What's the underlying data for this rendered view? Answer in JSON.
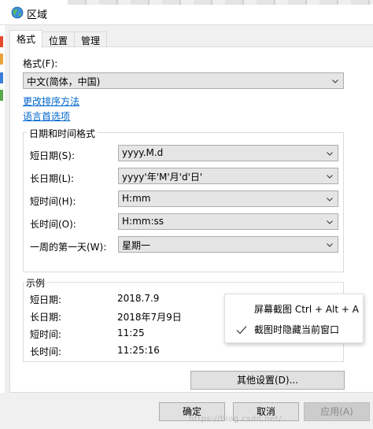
{
  "window": {
    "title": "区域"
  },
  "tabs": [
    {
      "label": "格式",
      "active": true
    },
    {
      "label": "位置",
      "active": false
    },
    {
      "label": "管理",
      "active": false
    }
  ],
  "format": {
    "label": "格式(F):",
    "value": "中文(简体，中国)"
  },
  "links": {
    "sort_method": "更改排序方法",
    "language_prefs": "语言首选项"
  },
  "datetime_group": {
    "title": "日期和时间格式",
    "rows": [
      {
        "label": "短日期(S):",
        "value": "yyyy.M.d"
      },
      {
        "label": "长日期(L):",
        "value": "yyyy'年'M'月'd'日'"
      },
      {
        "label": "短时间(H):",
        "value": "H:mm"
      },
      {
        "label": "长时间(O):",
        "value": "H:mm:ss"
      },
      {
        "label": "一周的第一天(W):",
        "value": "星期一"
      }
    ]
  },
  "example_group": {
    "title": "示例",
    "rows": [
      {
        "label": "短日期:",
        "value": "2018.7.9"
      },
      {
        "label": "长日期:",
        "value": "2018年7月9日"
      },
      {
        "label": "短时间:",
        "value": "11:25"
      },
      {
        "label": "长时间:",
        "value": "11:25:16"
      }
    ]
  },
  "context_menu": {
    "items": [
      {
        "label": "屏幕截图 Ctrl + Alt + A",
        "checked": false
      },
      {
        "label": "截图时隐藏当前窗口",
        "checked": true
      }
    ]
  },
  "buttons": {
    "other_settings": "其他设置(D)...",
    "ok": "确定",
    "cancel": "取消",
    "apply": "应用(A)"
  },
  "watermark": "https://blog.csdn.net/..."
}
